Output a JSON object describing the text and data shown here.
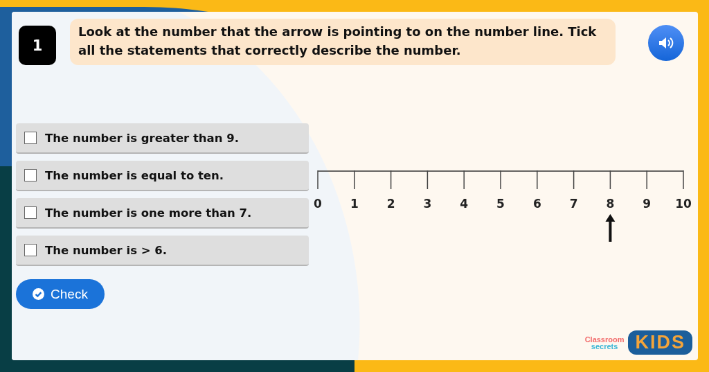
{
  "question": {
    "number": "1",
    "text": "Look at the number that the arrow is pointing to on the number line. Tick all the statements that correctly describe the number."
  },
  "options": [
    {
      "label": "The number is greater than 9.",
      "checked": false
    },
    {
      "label": "The number is equal to ten.",
      "checked": false
    },
    {
      "label": "The number is one more than 7.",
      "checked": false
    },
    {
      "label": "The number is > 6.",
      "checked": false
    }
  ],
  "check_button": {
    "label": "Check"
  },
  "number_line": {
    "labels": [
      {
        "text": "0",
        "pointed": false
      },
      {
        "text": "1",
        "pointed": false
      },
      {
        "text": "2",
        "pointed": false
      },
      {
        "text": "3",
        "pointed": false
      },
      {
        "text": "4",
        "pointed": false
      },
      {
        "text": "5",
        "pointed": false
      },
      {
        "text": "6",
        "pointed": false
      },
      {
        "text": "7",
        "pointed": false
      },
      {
        "text": "8",
        "pointed": true
      },
      {
        "text": "9",
        "pointed": false
      },
      {
        "text": "10",
        "pointed": false
      }
    ]
  },
  "logo": {
    "line_1": "Classroom",
    "line_2": "secrets",
    "badge": "KIDS"
  }
}
